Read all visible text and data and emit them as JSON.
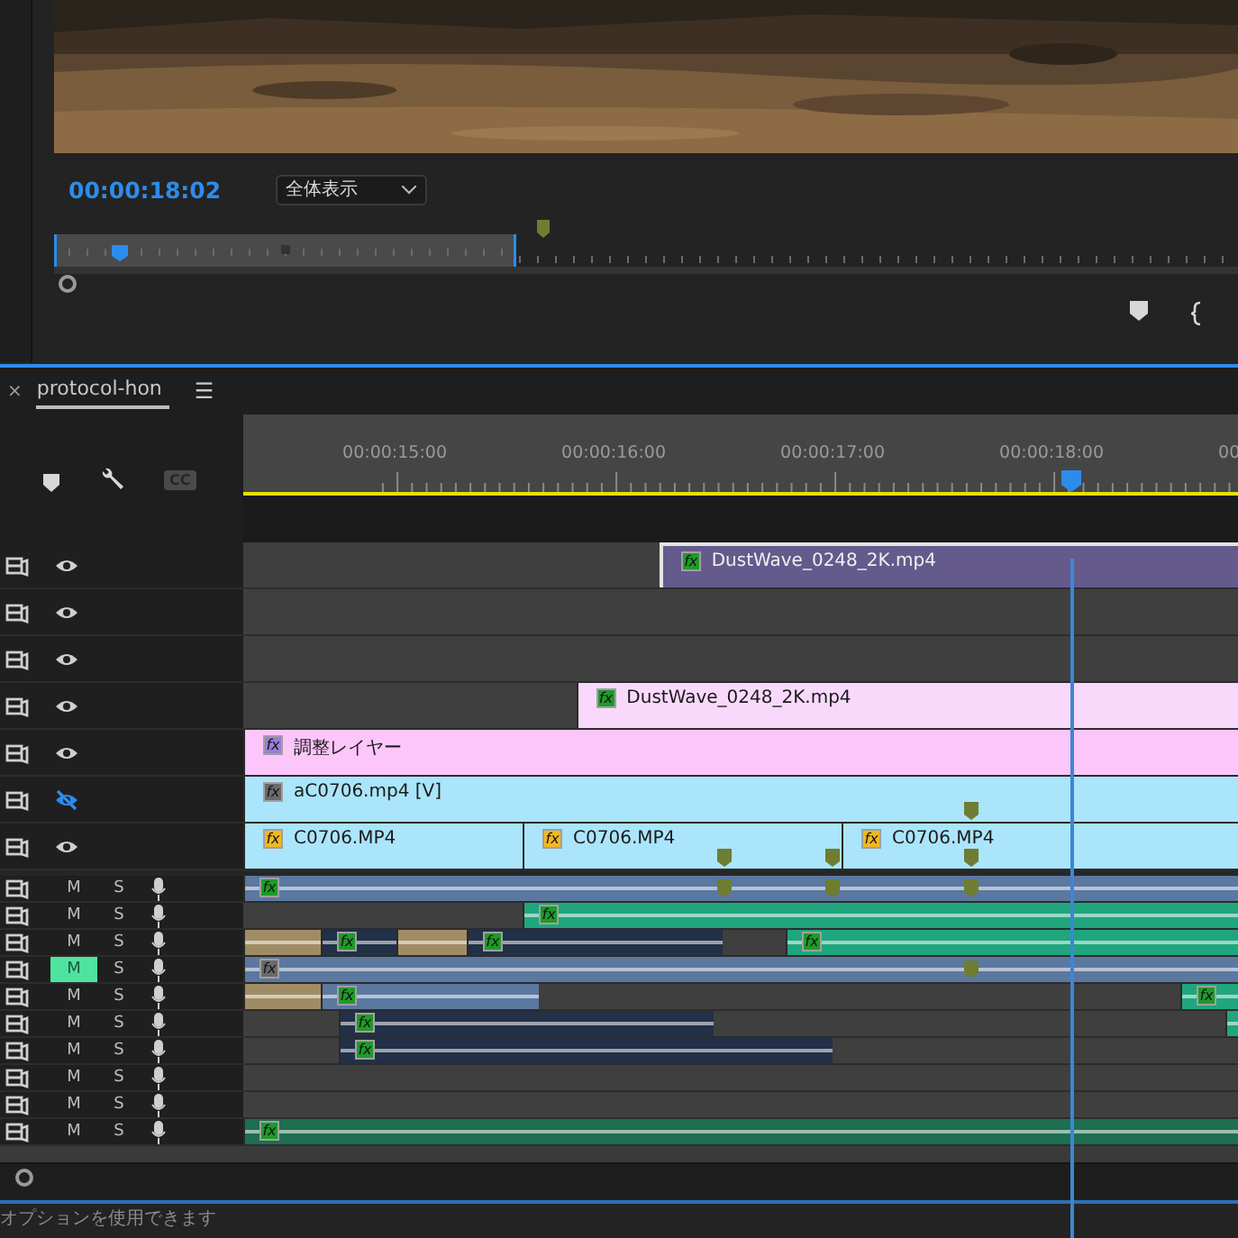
{
  "monitor": {
    "timecode": "00:00:18:02",
    "zoom_select": "全体表示"
  },
  "timeline_tab": {
    "close": "×",
    "title": "protocol-hon",
    "menu": "☰",
    "selected": true
  },
  "toolbar": {
    "captions": "CC"
  },
  "ruler": {
    "labels": [
      "00:00:15:00",
      "00:00:16:00",
      "00:00:17:00",
      "00:00:18:00",
      "00"
    ]
  },
  "video_tracks": [
    {
      "visible": true,
      "clips": [
        {
          "label": "DustWave_0248_2K.mp4",
          "color": "#645a8c",
          "badge": {
            "text": "fx",
            "color": "#1f9a2a"
          },
          "selected": true
        }
      ]
    },
    {
      "visible": true
    },
    {
      "visible": true
    },
    {
      "visible": true,
      "clips": [
        {
          "label": "DustWave_0248_2K.mp4",
          "color": "#f9d9fb",
          "badge": {
            "text": "fx",
            "color": "#1f9a2a"
          },
          "selected": false
        }
      ]
    },
    {
      "visible": true,
      "clips": [
        {
          "label": "調整レイヤー",
          "color": "#fcc6fb",
          "badge": {
            "text": "fx",
            "color": "#9a7ed6"
          },
          "selected": false
        }
      ]
    },
    {
      "visible": false,
      "clips": [
        {
          "label": "aC0706.mp4 [V]",
          "color": "#aae5fb",
          "badge": {
            "text": "fx",
            "color": "#6a6a6a"
          },
          "selected": false
        }
      ]
    },
    {
      "visible": true,
      "clips": [
        {
          "label": "C0706.MP4",
          "color": "#aae5fb",
          "badge": {
            "text": "fx",
            "color": "#f2b821"
          },
          "selected": false
        },
        {
          "label": "C0706.MP4",
          "color": "#aae5fb",
          "badge": {
            "text": "fx",
            "color": "#f2b821"
          },
          "selected": false
        },
        {
          "label": "C0706.MP4",
          "color": "#aae5fb",
          "badge": {
            "text": "fx",
            "color": "#f2b821"
          },
          "selected": false
        }
      ]
    }
  ],
  "audio_tracks": [
    {
      "mute": "M",
      "solo": "S",
      "muted": false,
      "clips": [
        {
          "color": "#5a78a0",
          "badge": {
            "text": "fx",
            "color": "#1f9a2a"
          }
        }
      ]
    },
    {
      "mute": "M",
      "solo": "S",
      "muted": false,
      "clips": [
        {
          "color": "#1fa67e",
          "badge": {
            "text": "fx",
            "color": "#1f9a2a"
          }
        }
      ]
    },
    {
      "mute": "M",
      "solo": "S",
      "muted": false,
      "clips": [
        {
          "color": "#a08c64"
        },
        {
          "color": "#223048",
          "badge": {
            "text": "fx",
            "color": "#1f9a2a"
          }
        },
        {
          "color": "#a08c64"
        },
        {
          "color": "#223048",
          "badge": {
            "text": "fx",
            "color": "#1f9a2a"
          }
        },
        {
          "color": "#1fa67e",
          "badge": {
            "text": "fx",
            "color": "#1f9a2a"
          }
        }
      ]
    },
    {
      "mute": "M",
      "solo": "S",
      "muted": true,
      "clips": [
        {
          "color": "#5a78a0",
          "badge": {
            "text": "fx",
            "color": "#6a6a6a"
          }
        }
      ]
    },
    {
      "mute": "M",
      "solo": "S",
      "muted": false,
      "clips": [
        {
          "color": "#a08c64"
        },
        {
          "color": "#5a78a0",
          "badge": {
            "text": "fx",
            "color": "#1f9a2a"
          }
        },
        {
          "color": "#1fa67e",
          "badge": {
            "text": "fx",
            "color": "#1f9a2a"
          }
        }
      ]
    },
    {
      "mute": "M",
      "solo": "S",
      "muted": false,
      "clips": [
        {
          "color": "#223048",
          "badge": {
            "text": "fx",
            "color": "#1f9a2a"
          }
        },
        {
          "color": "#1fa67e"
        }
      ]
    },
    {
      "mute": "M",
      "solo": "S",
      "muted": false,
      "clips": [
        {
          "color": "#223048",
          "badge": {
            "text": "fx",
            "color": "#1f9a2a"
          }
        }
      ]
    },
    {
      "mute": "M",
      "solo": "S",
      "muted": false
    },
    {
      "mute": "M",
      "solo": "S",
      "muted": false
    },
    {
      "mute": "M",
      "solo": "S",
      "muted": false,
      "clips": [
        {
          "color": "#1e6e50",
          "badge": {
            "text": "fx",
            "color": "#1f9a2a"
          }
        }
      ]
    }
  ],
  "status_bar": "オプションを使用できます"
}
